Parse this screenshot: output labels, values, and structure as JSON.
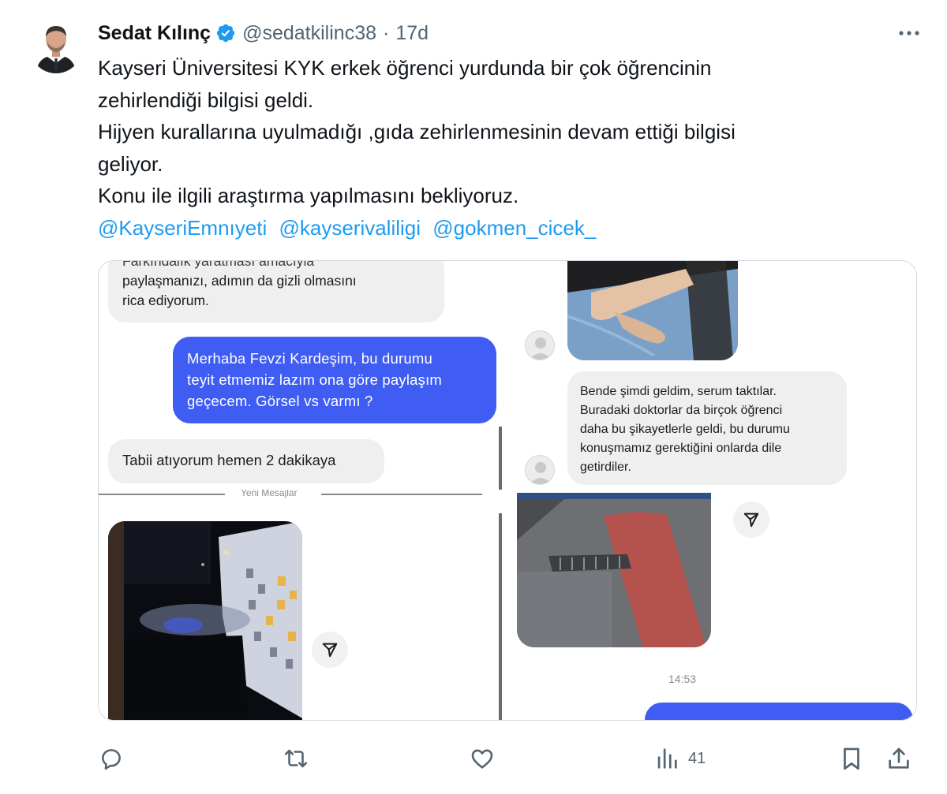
{
  "author": {
    "name": "Sedat Kılınç",
    "handle": "@sedatkilinc38",
    "separator": "·",
    "time": "17d",
    "verified": true
  },
  "tweet": {
    "lines": [
      "Kayseri Üniversitesi KYK erkek öğrenci yurdunda bir çok öğrencinin",
      "zehirlendiği bilgisi geldi.",
      "Hijyen kurallarına uyulmadığı ,gıda zehirlenmesinin devam ettiği bilgisi",
      "geliyor.",
      "Konu ile ilgili araştırma yapılmasını bekliyoruz."
    ],
    "mentions": [
      "@KayseriEmnıyeti",
      "@kayserivaliligi",
      "@gokmen_cicek_"
    ]
  },
  "media": {
    "left": {
      "msg1": [
        "Farkındalık yaratması amacıyla",
        "paylaşmanızı, adımın da gizli olmasını",
        "rica ediyorum."
      ],
      "msg2": [
        "Merhaba Fevzi Kardeşim, bu durumu",
        "teyit etmemiz lazım ona göre paylaşım",
        "geçecem. Görsel vs varmı ?"
      ],
      "msg3": "Tabii atıyorum hemen 2 dakikaya",
      "divider": "Yeni Mesajlar"
    },
    "right": {
      "msg1": [
        "Bende şimdi geldim, serum taktılar.",
        "Buradaki doktorlar da birçok öğrenci",
        "daha bu şikayetlerle geldi, bu durumu",
        "konuşmamız gerektiğini onlarda dile",
        "getirdiler."
      ],
      "timestamp": "14:53"
    }
  },
  "actions": {
    "reply": "reply-icon",
    "retweet": "retweet-icon",
    "like": "heart-icon",
    "views": "41",
    "bookmark": "bookmark-icon",
    "share": "share-icon"
  },
  "colors": {
    "link": "#1d9bf0",
    "verified": "#1d9bf0",
    "bubble_blue": "#3f5df3",
    "muted": "#536471"
  }
}
